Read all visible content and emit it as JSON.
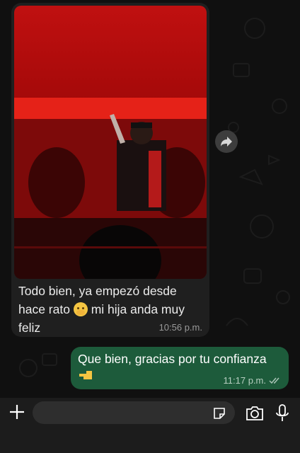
{
  "messages": [
    {
      "direction": "incoming",
      "has_media": true,
      "text_line1": "Todo bien, ya empezó desde",
      "text_line2a": "hace rato ",
      "text_line2b": " mi hija anda muy",
      "text_line3": "feliz",
      "time": "10:56 p.m."
    },
    {
      "direction": "outgoing",
      "text": "Que bien, gracias por tu confianza",
      "time": "11:17 p.m.",
      "status": "read"
    }
  ],
  "icons": {
    "forward": "forward-icon",
    "attach": "plus-icon",
    "sticker": "sticker-icon",
    "camera": "camera-icon",
    "mic": "microphone-icon"
  },
  "input": {
    "placeholder": "",
    "value": ""
  },
  "colors": {
    "incoming_bubble": "#1f1f1f",
    "outgoing_bubble": "#1d5b3b",
    "background": "#101010",
    "read_ticks": "#a9c4b6"
  }
}
